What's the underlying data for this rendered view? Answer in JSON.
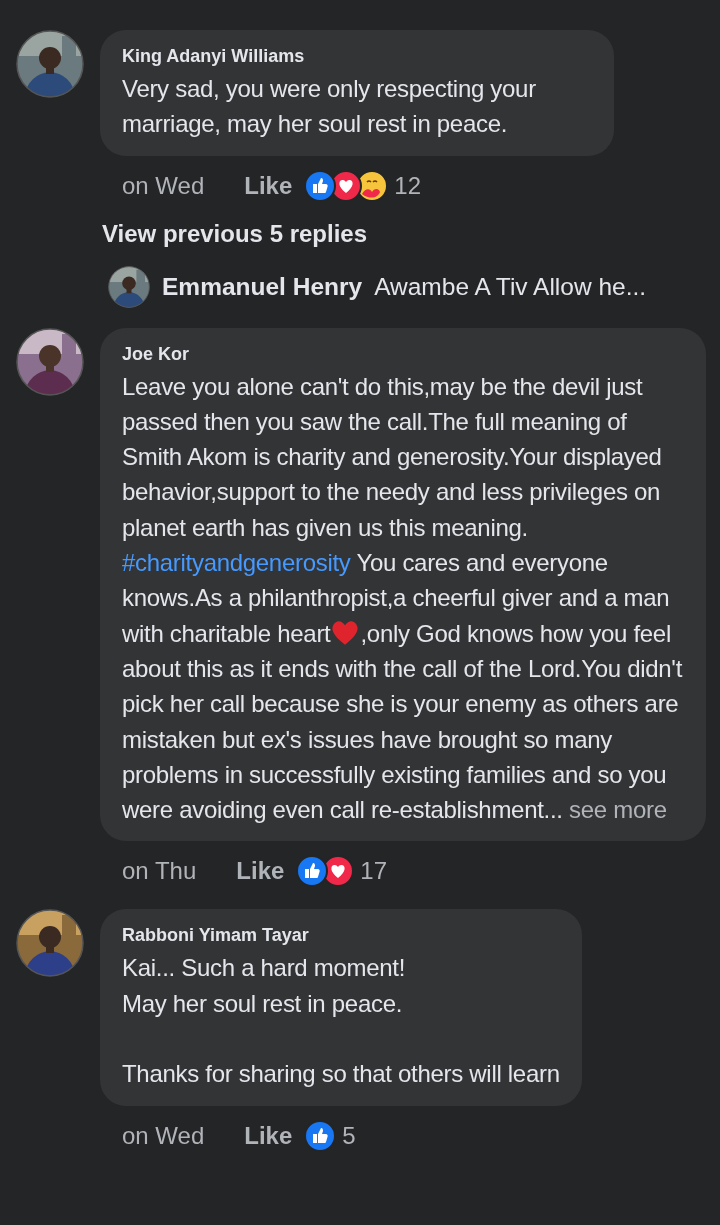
{
  "comments": [
    {
      "author": "King Adanyi Williams",
      "avatar": {
        "kind": "picture"
      },
      "body": [
        {
          "kind": "text",
          "text": "Very sad, you were only respecting your marriage, may her soul rest in peace."
        }
      ],
      "time": "on Wed",
      "like": "Like",
      "reactions": [
        {
          "kind": "like"
        },
        {
          "kind": "love"
        },
        {
          "kind": "care"
        }
      ],
      "count": "12"
    },
    {
      "author": "Joe Kor",
      "avatar": {
        "kind": "picture"
      },
      "body": [
        {
          "kind": "text",
          "text": "Leave you alone can't do this,may be the devil just passed then you saw the call.The full meaning of Smith Akom is charity and generosity.Your displayed behavior,support to the needy and less privileges on planet earth has given us this meaning. "
        },
        {
          "kind": "hashtag",
          "text": "#charityandgenerosity"
        },
        {
          "kind": "text",
          "text": " You cares and everyone knows.As a philanthropist,a cheerful giver and a man with charitable heart"
        },
        {
          "kind": "heart"
        },
        {
          "kind": "text",
          "text": ",only God knows how you feel about this as it ends with the call of the Lord.You didn't pick her call because she is your enemy as others are mistaken but ex's issues have brought so many problems in successfully existing families and so you were avoiding even call re-establishment..."
        },
        {
          "kind": "more",
          "text": " see more"
        }
      ],
      "time": "on Thu",
      "like": "Like",
      "reactions": [
        {
          "kind": "like"
        },
        {
          "kind": "love"
        }
      ],
      "count": "17"
    },
    {
      "author": "Rabboni Yimam Tayar",
      "avatar": {
        "kind": "picture"
      },
      "body": [
        {
          "kind": "text",
          "text": "Kai... Such a hard moment!\nMay her soul rest in peace.\n\nThanks for sharing so that others will learn"
        }
      ],
      "time": "on Wed",
      "like": "Like",
      "reactions": [
        {
          "kind": "like"
        }
      ],
      "count": "5"
    }
  ],
  "view_previous": "View previous 5 replies",
  "collapsed_reply": {
    "author": "Emmanuel Henry",
    "avatar": {
      "kind": "picture"
    },
    "text": "Awambe A Tiv Allow he..."
  }
}
